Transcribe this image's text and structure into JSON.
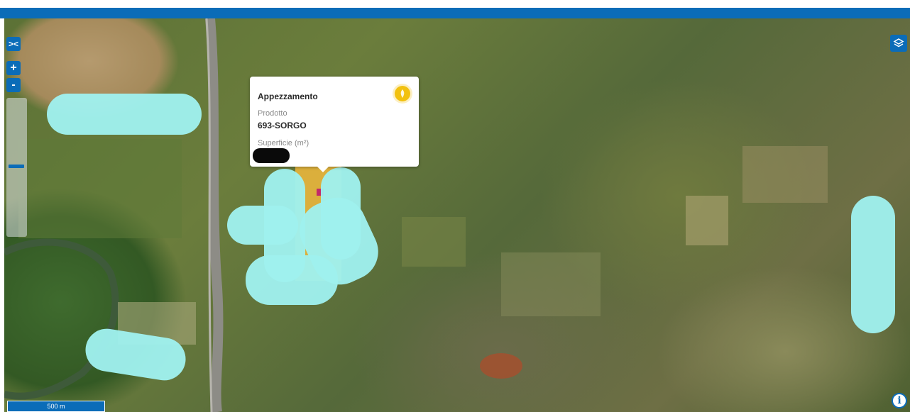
{
  "colors": {
    "accent": "#0b6cb8",
    "parcel_fill": "#e2b23c",
    "redaction": "#9ff0ee",
    "popup_marker": "#f2c10f"
  },
  "controls": {
    "collapse_icon": "chevrons-icon",
    "zoom_in_label": "+",
    "zoom_out_label": "-",
    "layers_icon": "layers-icon",
    "info_label": "i"
  },
  "scale": {
    "label": "500 m"
  },
  "popup": {
    "title": "Appezzamento",
    "marker_icon": "parcel-marker-icon",
    "field1_label": "Prodotto",
    "field1_value": "693-SORGO",
    "field2_label": "Superficie (m²)"
  }
}
